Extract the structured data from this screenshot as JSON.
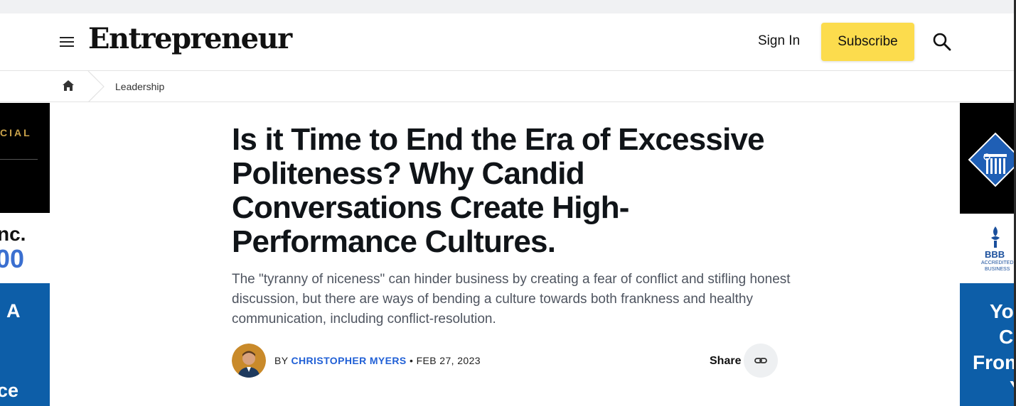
{
  "header": {
    "logo_text": "Entrepreneur",
    "signin_label": "Sign In",
    "subscribe_label": "Subscribe",
    "accent_color": "#fcdc4d"
  },
  "breadcrumb": {
    "home_icon": "home-icon",
    "items": [
      {
        "label": "Leadership"
      }
    ]
  },
  "article": {
    "title": "Is it Time to End the Era of Excessive Politeness? Why Candid Conversations Create High-Performance Cultures.",
    "dek": "The \"tyranny of niceness\" can hinder business by creating a fear of conflict and stifling honest discussion, but there are ways of bending a culture towards both frankness and healthy communication, including conflict-resolution.",
    "byline": {
      "prefix": "BY",
      "author": "CHRISTOPHER MYERS",
      "separator": "•",
      "date": "FEB 27, 2023"
    },
    "share_label": "Share",
    "share_icon": "link-icon"
  },
  "ads": {
    "left_top_text": "CIAL",
    "left_mid_text": "nc.",
    "left_mid_number": "00",
    "left_bot_top": "A",
    "left_bot_bottom": "ce",
    "right_mid_text_1": "BBB",
    "right_mid_text_2": "ACCREDITED",
    "right_mid_text_3": "BUSINESS",
    "right_bot_lines": [
      "Yo",
      "C",
      "From",
      "Y"
    ]
  }
}
